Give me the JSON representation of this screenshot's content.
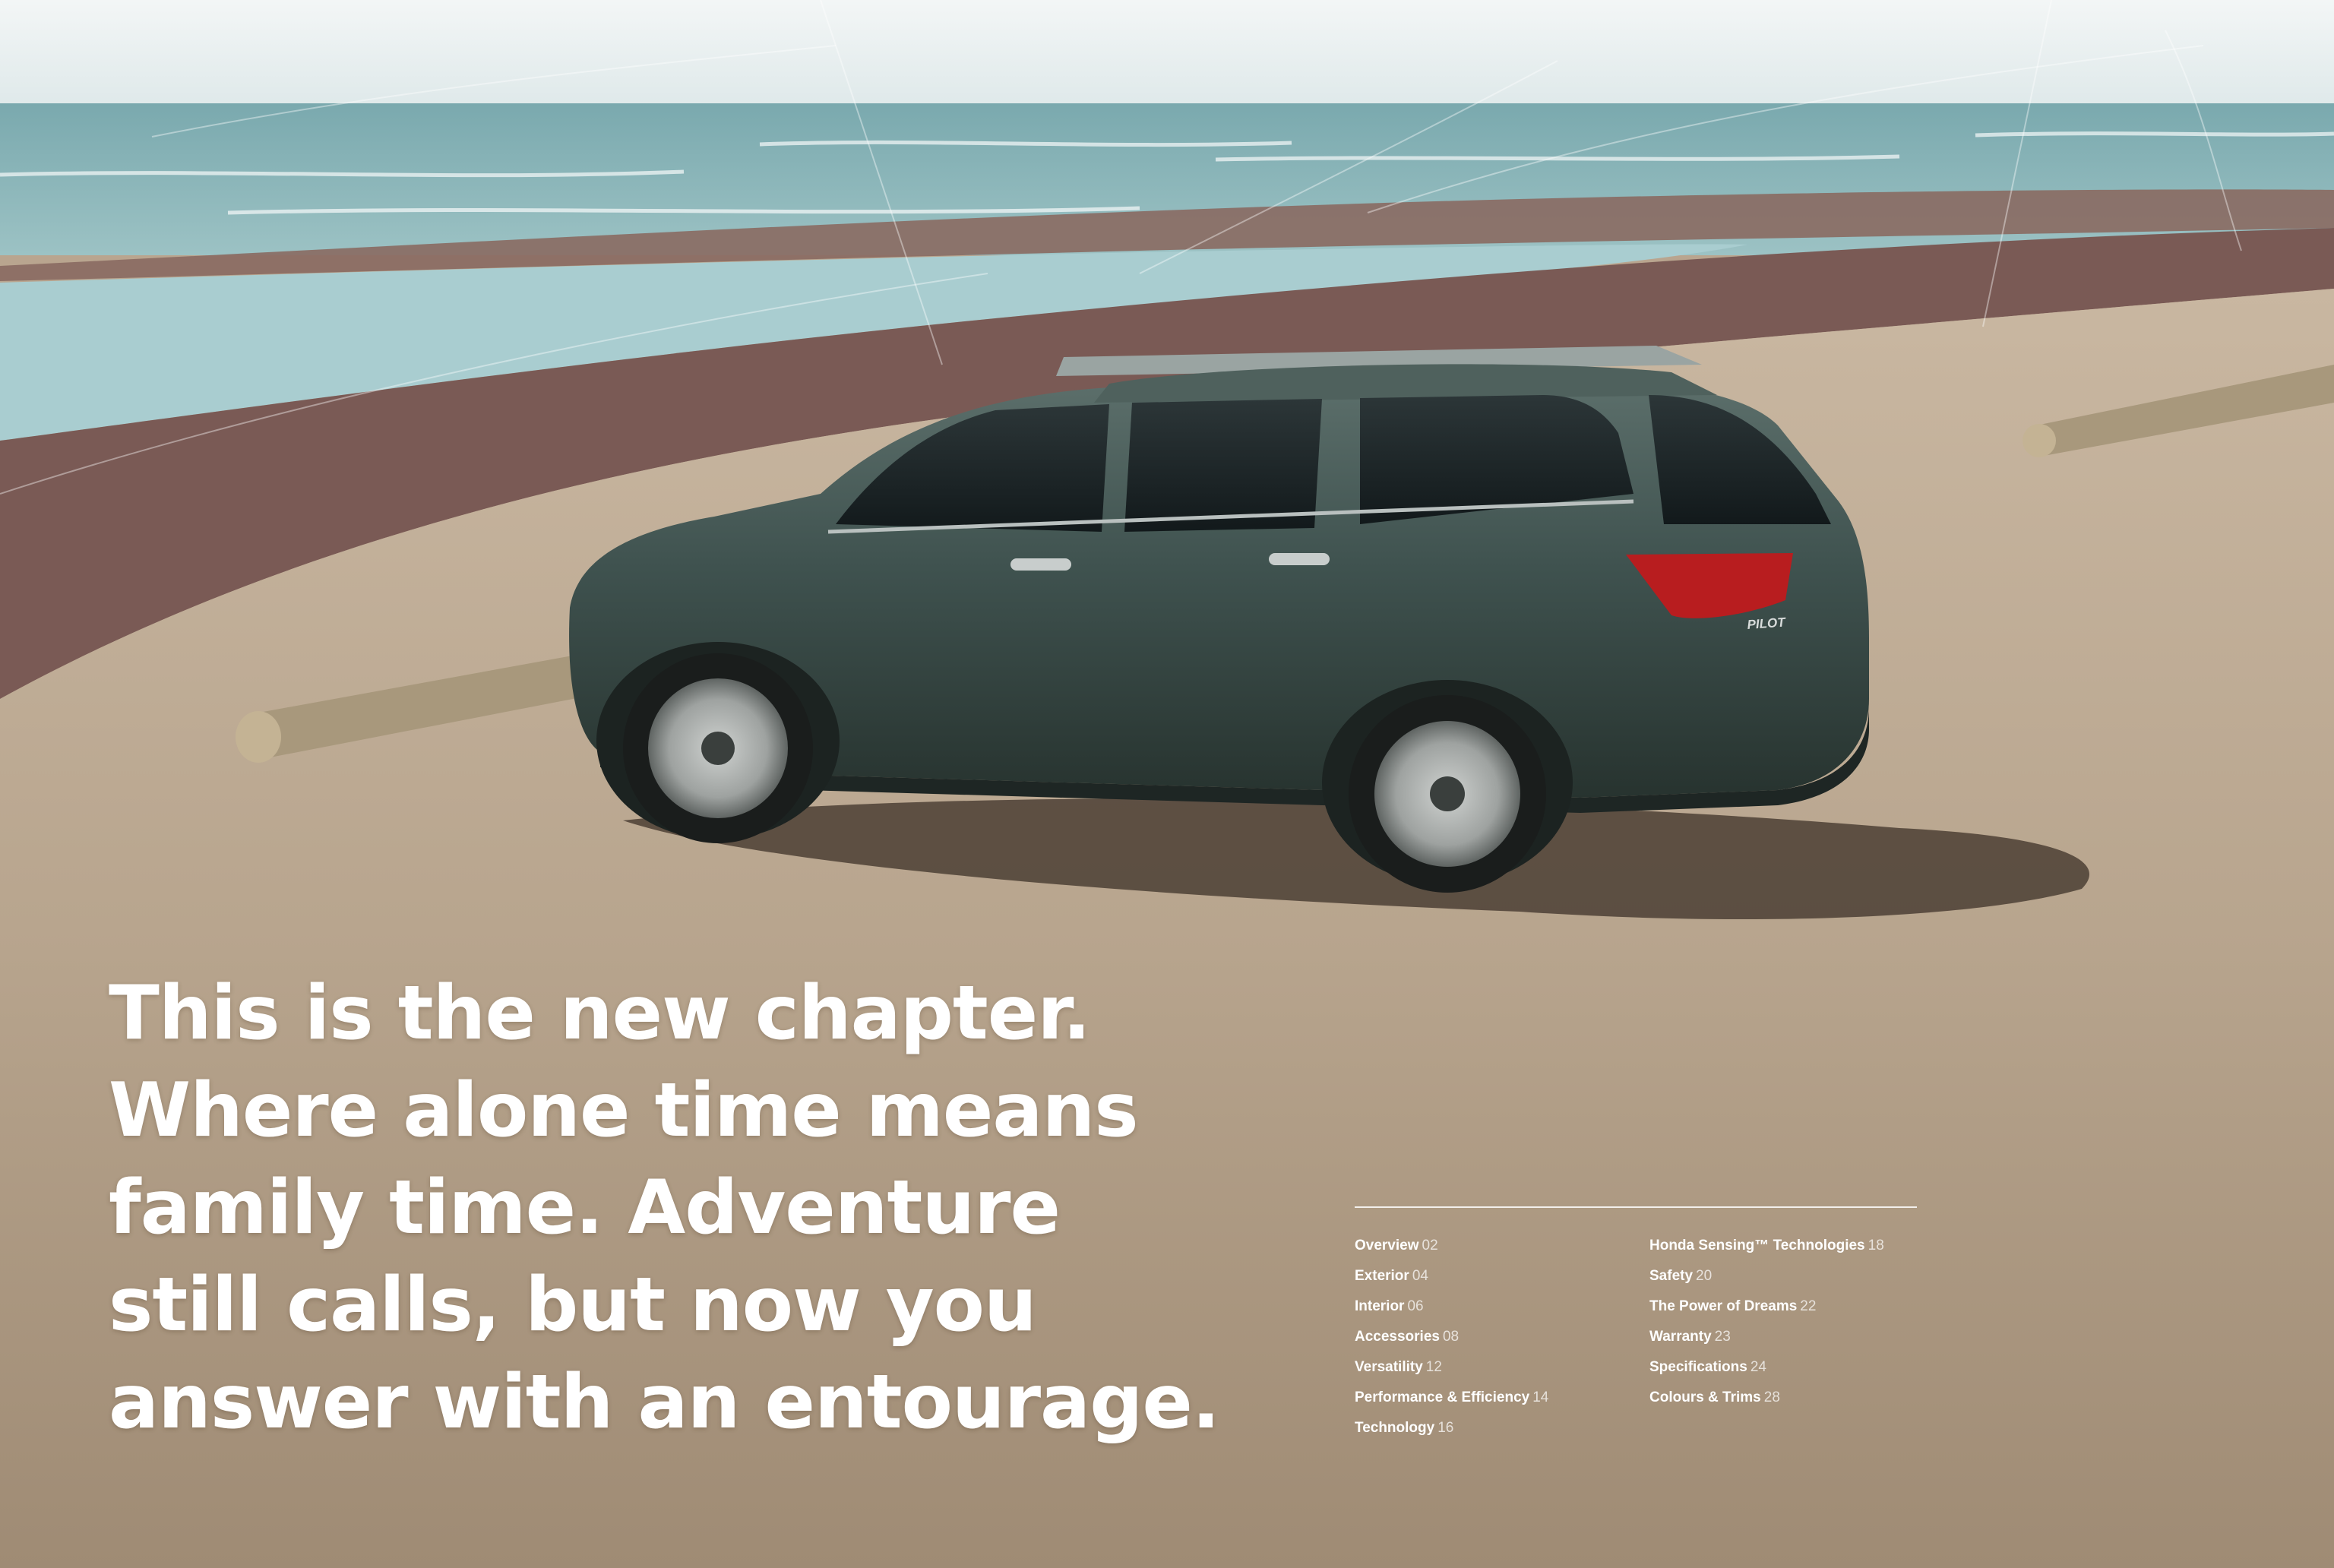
{
  "headline": {
    "lines": [
      "This is the new chapter.",
      "Where alone time means",
      "family time. Adventure",
      "still calls, but now you",
      "answer with an entourage."
    ]
  },
  "vehicle": {
    "badge": "PILOT"
  },
  "contents": {
    "left": [
      {
        "label": "Overview",
        "page": "02"
      },
      {
        "label": "Exterior",
        "page": "04"
      },
      {
        "label": "Interior",
        "page": "06"
      },
      {
        "label": "Accessories",
        "page": "08"
      },
      {
        "label": "Versatility",
        "page": "12"
      },
      {
        "label": "Performance & Efficiency",
        "page": "14"
      },
      {
        "label": "Technology",
        "page": "16"
      }
    ],
    "right": [
      {
        "label": "Honda Sensing™ Technologies",
        "page": "18"
      },
      {
        "label": "Safety",
        "page": "20"
      },
      {
        "label": "The Power of Dreams",
        "page": "22"
      },
      {
        "label": "Warranty",
        "page": "23"
      },
      {
        "label": "Specifications",
        "page": "24"
      },
      {
        "label": "Colours & Trims",
        "page": "28"
      }
    ]
  },
  "colors": {
    "sky": "#eef3f3",
    "ocean": "#6f9ea4",
    "sand": "#b9a58f",
    "pebbles": "#7a5a55",
    "vehicle_body": "#3f524f",
    "text": "#ffffff"
  }
}
